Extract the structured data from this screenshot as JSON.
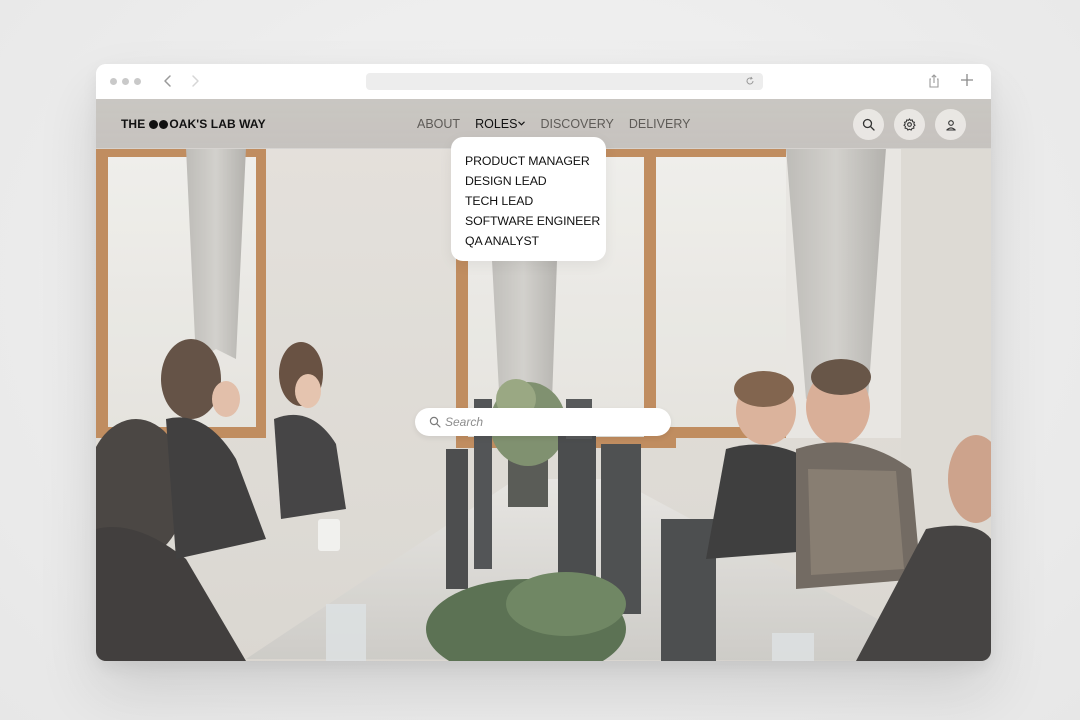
{
  "brand": {
    "prefix": "THE",
    "suffix": "OAK'S LAB WAY"
  },
  "nav": {
    "items": [
      {
        "label": "ABOUT",
        "active": false
      },
      {
        "label": "ROLES",
        "active": true,
        "has_dropdown": true
      },
      {
        "label": "DISCOVERY",
        "active": false
      },
      {
        "label": "DELIVERY",
        "active": false
      }
    ]
  },
  "roles_dropdown": {
    "items": [
      "PRODUCT MANAGER",
      "DESIGN LEAD",
      "TECH LEAD",
      "SOFTWARE ENGINEER",
      "QA ANALYST"
    ]
  },
  "search": {
    "placeholder": "Search",
    "value": ""
  },
  "header_actions": {
    "icons": [
      "search-icon",
      "gear-icon",
      "user-icon"
    ]
  },
  "colors": {
    "header_bg": "#c8c5c1",
    "text_dark": "#111111",
    "text_muted": "#5e5b57",
    "dropdown_bg": "#ffffff"
  }
}
